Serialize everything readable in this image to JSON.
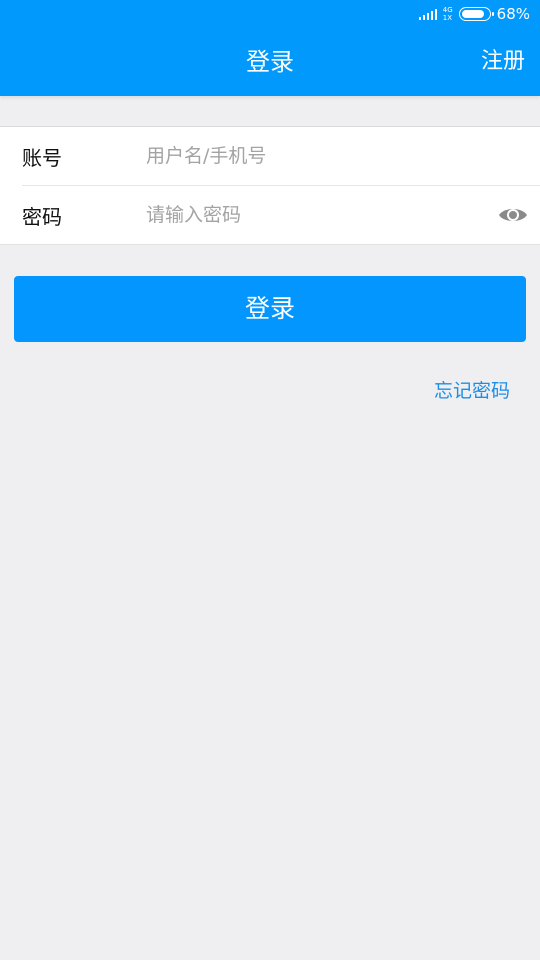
{
  "status_bar": {
    "network_top": "4G",
    "network_bottom": "1X",
    "battery_percent": "68%",
    "battery_level": 0.68,
    "icons": [
      "signal-icon",
      "battery-icon"
    ]
  },
  "header": {
    "title": "登录",
    "register_label": "注册",
    "background_color": "#0299fd"
  },
  "form": {
    "account": {
      "label": "账号",
      "placeholder": "用户名/手机号",
      "value": ""
    },
    "password": {
      "label": "密码",
      "placeholder": "请输入密码",
      "value": "",
      "toggle_icon": "eye-icon"
    }
  },
  "actions": {
    "login_label": "登录",
    "forgot_password_label": "忘记密码",
    "button_color": "#0396fe",
    "link_color": "#1b8fe8"
  }
}
